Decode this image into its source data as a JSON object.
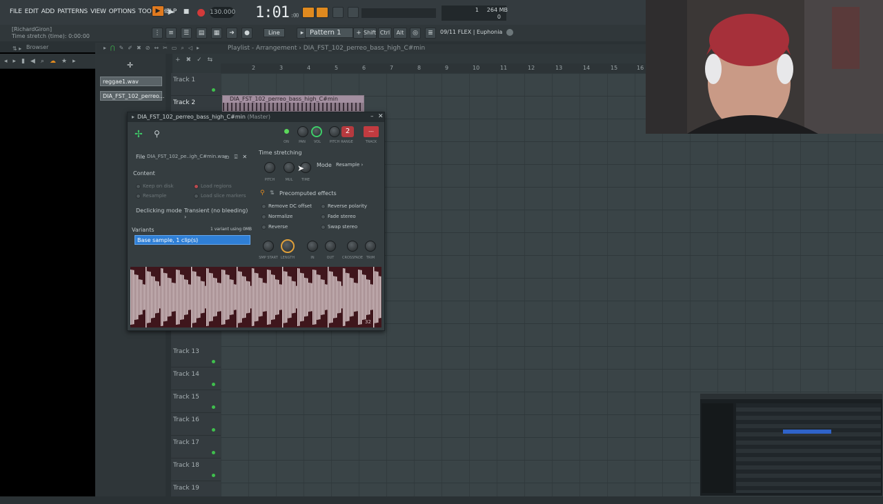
{
  "menu": [
    "FILE",
    "EDIT",
    "ADD",
    "PATTERNS",
    "VIEW",
    "OPTIONS",
    "TOOLS",
    "HELP"
  ],
  "hint": {
    "user": "[RichardGiron]",
    "line": "Time stretch (time): 0:00:00"
  },
  "transport": {
    "bpm": "130.000",
    "time": "1:01",
    "time_sub": ":00",
    "pattern": "Pattern 1",
    "snap": "Line"
  },
  "cpu": {
    "voices": "1",
    "mem": "264 MB",
    "zero": "0"
  },
  "flex": "09/11  FLEX | Euphonia",
  "keys": [
    "Shift",
    "Ctrl",
    "Alt"
  ],
  "browser": {
    "label": "Browser"
  },
  "playlist": {
    "title": "Playlist - Arrangement",
    "sep": "›",
    "pattern_name": "DIA_FST_102_perreo_bass_high_C#min",
    "clips": [
      "reggae1.wav",
      "DIA_FST_102_perreo..."
    ],
    "ruler": [
      "2",
      "3",
      "4",
      "5",
      "6",
      "7",
      "8",
      "9",
      "10",
      "11",
      "12",
      "13",
      "14",
      "15",
      "16"
    ],
    "tracks_top": [
      "Track 1",
      "Track 2"
    ],
    "tracks_bottom": [
      "Track 13",
      "Track 14",
      "Track 15",
      "Track 16",
      "Track 17",
      "Track 18",
      "Track 19"
    ],
    "clip_label": "DIA_FST_102_perreo_bass_high_C#min"
  },
  "channel": {
    "title": "DIA_FST_102_perreo_bass_high_C#min",
    "master": "(Master)",
    "knob_labels": [
      "ON",
      "PAN",
      "VOL",
      "PITCH",
      "RANGE",
      "TRACK"
    ],
    "range_value": "2",
    "track_value": "---",
    "file_label": "File",
    "file_name": "DIA_FST_102_pe..igh_C#min.wav",
    "content_label": "Content",
    "content_opts": [
      "Keep on disk",
      "Load regions",
      "Resample",
      "Load slice markers"
    ],
    "declick_label": "Declicking mode",
    "declick_value": "Transient (no bleeding)",
    "variants_label": "Variants",
    "variants_info": "1 variant using 0MB",
    "variant_item": "Base sample, 1 clip(s)",
    "ts_label": "Time stretching",
    "ts_knobs": [
      "PITCH",
      "MUL",
      "TIME"
    ],
    "mode_label": "Mode",
    "mode_value": "Resample",
    "pre_label": "Precomputed effects",
    "effects_left": [
      "Remove DC offset",
      "Normalize",
      "Reverse"
    ],
    "effects_right": [
      "Reverse polarity",
      "Fade stereo",
      "Swap stereo"
    ],
    "bottom_knobs": [
      "SMP START",
      "LENGTH",
      "IN",
      "OUT",
      "CROSSFADE",
      "TRIM"
    ],
    "wave_corner": "32"
  }
}
